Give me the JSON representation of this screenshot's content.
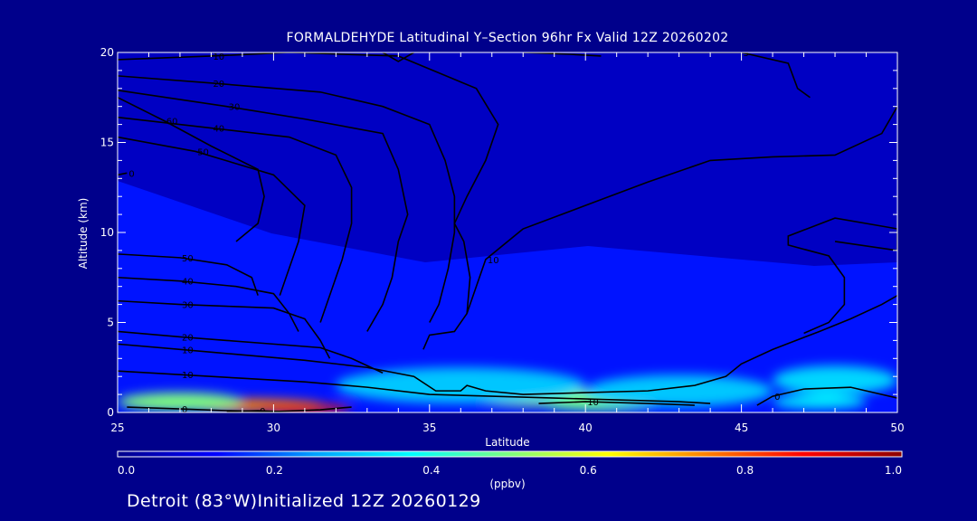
{
  "chart_data": {
    "type": "heatmap",
    "title": "FORMALDEHYDE Latitudinal Y–Section 96hr  Fx Valid 12Z 20260202",
    "xlabel": "Latitude",
    "ylabel": "Altitude (km)",
    "xlim": [
      25,
      50
    ],
    "ylim": [
      0,
      20
    ],
    "x_ticks": [
      "25",
      "30",
      "35",
      "40",
      "45",
      "50"
    ],
    "y_ticks": [
      "0",
      "5",
      "10",
      "15",
      "20"
    ],
    "colorbar": {
      "min": 0.0,
      "max": 1.0,
      "ticks": [
        "0.0",
        "0.2",
        "0.4",
        "0.6",
        "0.8",
        "1.0"
      ],
      "unit": "(ppbv)",
      "colors": [
        "#00008b",
        "#0000ff",
        "#00a0ff",
        "#00ffff",
        "#7fff7f",
        "#ffff00",
        "#ff8000",
        "#ff0000",
        "#8b0000"
      ]
    },
    "field_blobs": [
      {
        "lat": 29.0,
        "alt": 0.4,
        "value": 0.75,
        "sx": 2.6,
        "sy": 0.35
      },
      {
        "lat": 31.0,
        "alt": 0.2,
        "value": 0.85,
        "sx": 1.5,
        "sy": 0.25
      },
      {
        "lat": 27.0,
        "alt": 0.6,
        "value": 0.5,
        "sx": 2.0,
        "sy": 0.5
      },
      {
        "lat": 38.5,
        "alt": 0.8,
        "value": 0.52,
        "sx": 2.5,
        "sy": 0.45
      },
      {
        "lat": 40.5,
        "alt": 0.5,
        "value": 0.48,
        "sx": 2.0,
        "sy": 0.4
      },
      {
        "lat": 36.0,
        "alt": 1.5,
        "value": 0.3,
        "sx": 4.0,
        "sy": 1.0
      },
      {
        "lat": 43.0,
        "alt": 1.2,
        "value": 0.3,
        "sx": 3.0,
        "sy": 0.9
      },
      {
        "lat": 48.0,
        "alt": 1.8,
        "value": 0.32,
        "sx": 2.0,
        "sy": 0.8
      },
      {
        "lat": 47.5,
        "alt": 0.6,
        "value": 0.35,
        "sx": 1.5,
        "sy": 0.4
      }
    ],
    "contours": [
      {
        "label": "0",
        "points": [
          [
            25.3,
            0.3
          ],
          [
            27,
            0.2
          ],
          [
            28.5,
            0.1
          ],
          [
            30,
            0.05
          ],
          [
            31.5,
            0.15
          ],
          [
            32.5,
            0.3
          ]
        ]
      },
      {
        "label": "0",
        "points": [
          [
            28.5,
            0.05
          ],
          [
            29.5,
            0.1
          ],
          [
            30.2,
            0.05
          ]
        ]
      },
      {
        "label": "10",
        "points": [
          [
            25,
            2.3
          ],
          [
            27,
            2.1
          ],
          [
            29,
            1.9
          ],
          [
            31,
            1.7
          ],
          [
            33,
            1.4
          ],
          [
            35,
            1.0
          ],
          [
            37,
            0.9
          ],
          [
            39,
            0.8
          ],
          [
            41,
            0.7
          ],
          [
            43,
            0.6
          ],
          [
            44,
            0.5
          ]
        ]
      },
      {
        "label": "10",
        "points": [
          [
            25,
            3.8
          ],
          [
            27,
            3.5
          ],
          [
            29,
            3.2
          ],
          [
            31,
            2.9
          ],
          [
            33,
            2.5
          ],
          [
            34.5,
            2.0
          ],
          [
            35.2,
            1.2
          ],
          [
            36,
            1.2
          ],
          [
            36.2,
            1.5
          ],
          [
            36.8,
            1.2
          ],
          [
            38,
            1.0
          ],
          [
            40,
            1.1
          ],
          [
            42,
            1.2
          ],
          [
            43.5,
            1.5
          ],
          [
            44.5,
            2.0
          ],
          [
            45,
            2.7
          ],
          [
            46,
            3.5
          ],
          [
            47.5,
            4.5
          ],
          [
            48.5,
            5.2
          ],
          [
            49.5,
            6.0
          ],
          [
            50,
            6.5
          ]
        ]
      },
      {
        "label": "20",
        "points": [
          [
            25,
            4.5
          ],
          [
            27,
            4.2
          ],
          [
            28.5,
            4.0
          ],
          [
            30,
            3.8
          ],
          [
            31.5,
            3.6
          ],
          [
            32.5,
            3.0
          ],
          [
            33.5,
            2.2
          ]
        ]
      },
      {
        "label": "30",
        "points": [
          [
            25,
            6.2
          ],
          [
            27,
            6.0
          ],
          [
            28.5,
            5.9
          ],
          [
            30,
            5.8
          ],
          [
            31,
            5.2
          ],
          [
            31.5,
            4.0
          ],
          [
            31.8,
            3.0
          ]
        ]
      },
      {
        "label": "40",
        "points": [
          [
            25,
            7.5
          ],
          [
            27,
            7.3
          ],
          [
            28.8,
            7.0
          ],
          [
            30,
            6.6
          ],
          [
            30.5,
            5.5
          ],
          [
            30.8,
            4.5
          ]
        ]
      },
      {
        "label": "50",
        "points": [
          [
            25,
            8.8
          ],
          [
            27,
            8.6
          ],
          [
            28.5,
            8.2
          ],
          [
            29.3,
            7.5
          ],
          [
            29.5,
            6.5
          ]
        ]
      },
      {
        "label": "60",
        "points": [
          [
            25,
            17.5
          ],
          [
            26.5,
            16.2
          ],
          [
            28,
            14.8
          ],
          [
            29.5,
            13.5
          ],
          [
            29.7,
            12.0
          ],
          [
            29.5,
            10.5
          ],
          [
            28.8,
            9.5
          ]
        ]
      },
      {
        "label": "50",
        "points": [
          [
            25,
            15.3
          ],
          [
            27.5,
            14.5
          ],
          [
            30,
            13.2
          ],
          [
            31,
            11.5
          ],
          [
            30.8,
            9.5
          ],
          [
            30.5,
            8.0
          ],
          [
            30.2,
            6.5
          ]
        ]
      },
      {
        "label": "40",
        "points": [
          [
            25,
            16.4
          ],
          [
            28,
            15.8
          ],
          [
            30.5,
            15.3
          ],
          [
            32,
            14.3
          ],
          [
            32.5,
            12.5
          ],
          [
            32.5,
            10.5
          ],
          [
            32.2,
            8.5
          ],
          [
            31.8,
            6.5
          ],
          [
            31.5,
            5.0
          ]
        ]
      },
      {
        "label": "30",
        "points": [
          [
            25,
            17.9
          ],
          [
            28.5,
            17.0
          ],
          [
            31,
            16.3
          ],
          [
            33.5,
            15.5
          ],
          [
            34,
            13.5
          ],
          [
            34.3,
            11.0
          ],
          [
            34,
            9.5
          ],
          [
            33.8,
            7.5
          ],
          [
            33.5,
            6.0
          ],
          [
            33,
            4.5
          ]
        ]
      },
      {
        "label": "20",
        "points": [
          [
            25,
            18.7
          ],
          [
            28,
            18.3
          ],
          [
            31.5,
            17.8
          ],
          [
            33.5,
            17.0
          ],
          [
            35,
            16.0
          ],
          [
            35.5,
            14.0
          ],
          [
            35.8,
            12.0
          ],
          [
            35.8,
            10.0
          ],
          [
            35.6,
            8.0
          ],
          [
            35.3,
            6.0
          ],
          [
            35,
            5.0
          ]
        ]
      },
      {
        "label": "10",
        "points": [
          [
            25,
            19.6
          ],
          [
            28,
            19.8
          ],
          [
            30.5,
            20.0
          ],
          [
            34,
            19.8
          ],
          [
            36.5,
            18.0
          ],
          [
            37.2,
            16.0
          ],
          [
            36.8,
            14.0
          ],
          [
            36.2,
            12.0
          ],
          [
            35.8,
            10.5
          ],
          [
            36.1,
            9.5
          ],
          [
            36.3,
            7.5
          ],
          [
            36.2,
            5.5
          ],
          [
            35.8,
            4.5
          ],
          [
            35,
            4.3
          ],
          [
            34.8,
            3.5
          ]
        ]
      },
      {
        "label": "10",
        "points": [
          [
            36.2,
            5.5
          ],
          [
            36.8,
            8.5
          ],
          [
            38,
            10.2
          ],
          [
            40,
            11.5
          ],
          [
            42,
            12.8
          ],
          [
            44,
            14.0
          ],
          [
            46,
            14.2
          ],
          [
            48,
            14.3
          ],
          [
            49.5,
            15.5
          ],
          [
            50,
            17
          ]
        ]
      },
      {
        "label": "5",
        "points": [
          [
            43,
            20.0
          ],
          [
            45,
            20.0
          ],
          [
            46.5,
            19.4
          ],
          [
            46.8,
            18.0
          ],
          [
            47.2,
            17.5
          ]
        ]
      },
      {
        "label": "0",
        "points": [
          [
            25,
            13.2
          ],
          [
            25.3,
            13.3
          ]
        ]
      },
      {
        "label": "",
        "points": [
          [
            38,
            20.0
          ],
          [
            39.5,
            19.9
          ],
          [
            40.5,
            19.8
          ]
        ]
      },
      {
        "label": "",
        "points": [
          [
            33.5,
            20.0
          ],
          [
            34,
            19.5
          ],
          [
            34.5,
            20.0
          ]
        ]
      },
      {
        "label": "0",
        "points": [
          [
            48,
            9.5
          ],
          [
            50,
            9.0
          ],
          [
            50,
            10.2
          ],
          [
            48,
            10.8
          ],
          [
            46.5,
            9.8
          ],
          [
            46.5,
            9.3
          ],
          [
            47.8,
            8.7
          ],
          [
            48.3,
            7.5
          ],
          [
            48.3,
            6.0
          ],
          [
            47.8,
            5.0
          ],
          [
            47,
            4.4
          ]
        ]
      },
      {
        "label": "0",
        "points": [
          [
            45.5,
            0.4
          ],
          [
            46,
            0.9
          ],
          [
            47,
            1.3
          ],
          [
            48.5,
            1.4
          ],
          [
            50,
            0.8
          ]
        ]
      },
      {
        "label": "10",
        "points": [
          [
            38.5,
            0.5
          ],
          [
            40,
            0.6
          ],
          [
            42,
            0.5
          ],
          [
            43.5,
            0.4
          ]
        ]
      }
    ]
  }
}
